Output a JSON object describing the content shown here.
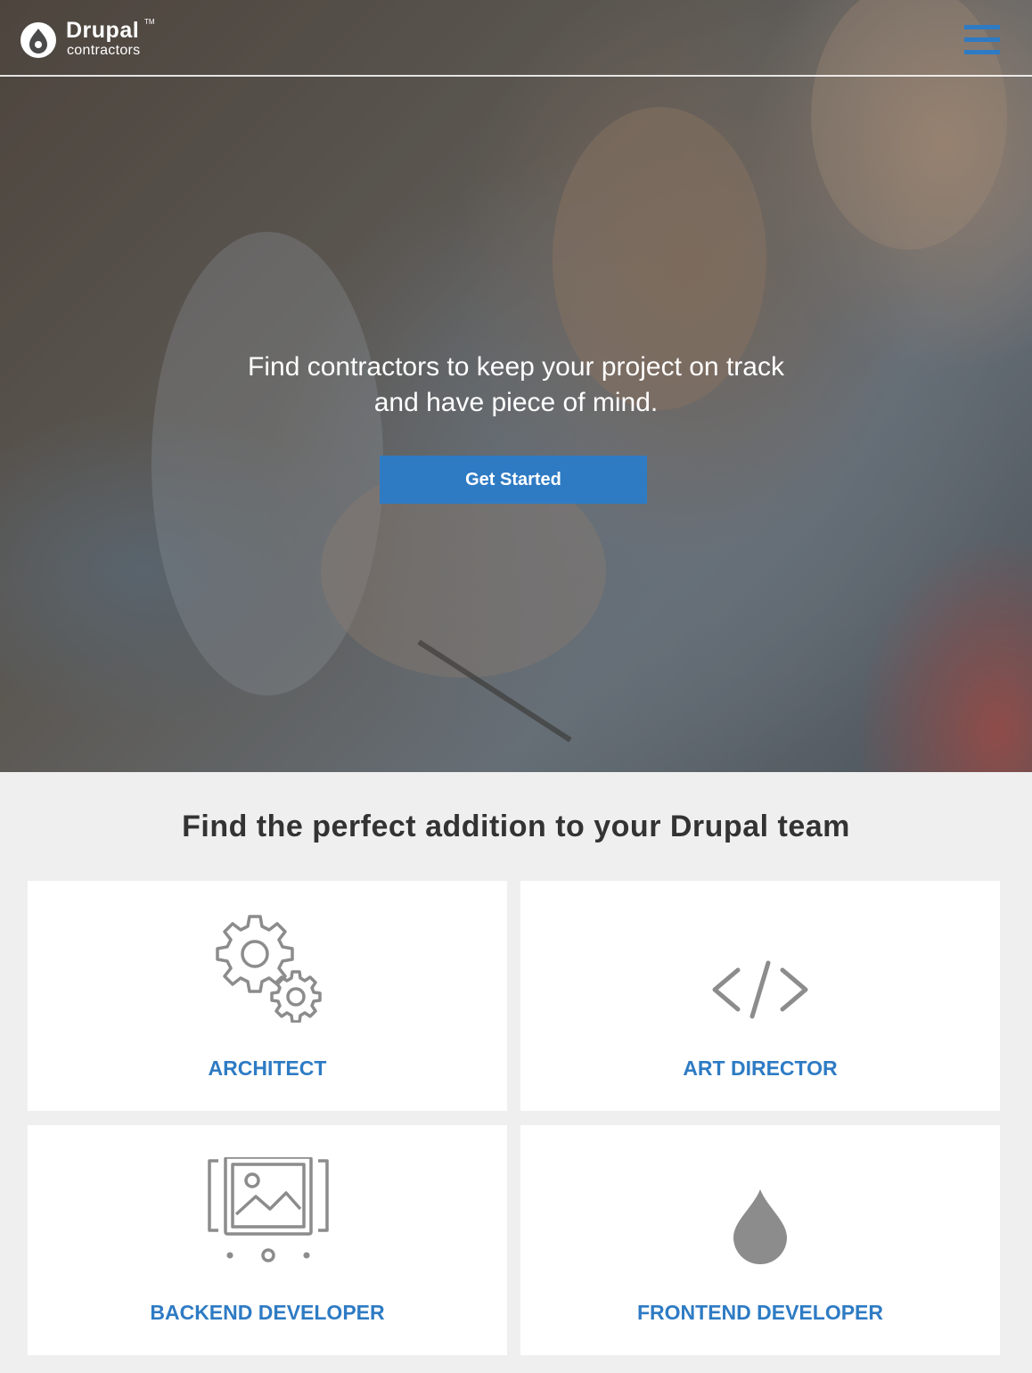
{
  "header": {
    "logo_name": "Drupal",
    "logo_tm": "TM",
    "logo_sub": "contractors",
    "menu_icon": "hamburger-menu-icon"
  },
  "hero": {
    "headline_line1": "Find contractors to keep your project on track",
    "headline_line2": "and have piece of mind.",
    "cta_label": "Get Started"
  },
  "main": {
    "section_title": "Find the perfect addition to your Drupal team",
    "roles": [
      {
        "label": "ARCHITECT",
        "icon": "gears-icon"
      },
      {
        "label": "ART DIRECTOR",
        "icon": "code-brackets-icon"
      },
      {
        "label": "BACKEND DEVELOPER",
        "icon": "image-gallery-icon"
      },
      {
        "label": "FRONTEND DEVELOPER",
        "icon": "drop-icon"
      }
    ]
  },
  "colors": {
    "accent": "#2e7bc4",
    "icon_gray": "#8c8c8c",
    "section_bg": "#efefef",
    "heading": "#333333"
  }
}
